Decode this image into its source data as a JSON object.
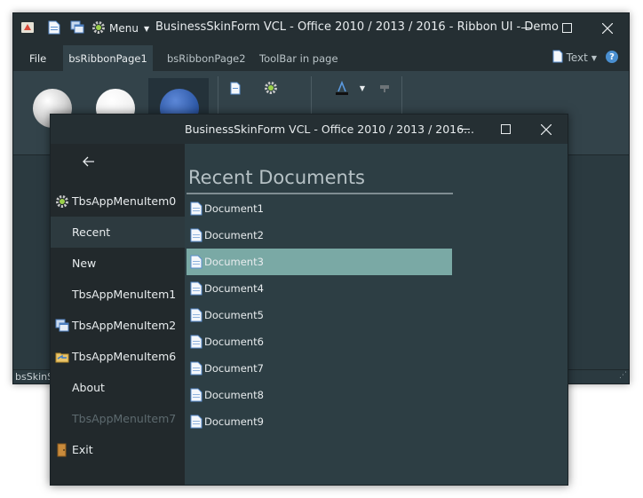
{
  "main_window": {
    "title": "BusinessSkinForm VCL - Office 2010 / 2013 / 2016 - Ribbon UI - Demo",
    "menu_label": "Menu",
    "tabs": [
      {
        "label": "File"
      },
      {
        "label": "bsRibbonPage1"
      },
      {
        "label": "bsRibbonPage2"
      },
      {
        "label": "ToolBar in page"
      }
    ],
    "text_button_label": "Text",
    "help_label": "?",
    "status_text": "bsSkinSt"
  },
  "app_menu_window": {
    "title": "BusinessSkinForm VCL - Office 2010 / 2013 / 2016...",
    "sidebar_items": [
      {
        "label": "TbsAppMenuItem0",
        "icon": "gear-icon"
      },
      {
        "label": "Recent",
        "icon": ""
      },
      {
        "label": "New",
        "icon": ""
      },
      {
        "label": "TbsAppMenuItem1",
        "icon": ""
      },
      {
        "label": "TbsAppMenuItem2",
        "icon": "copy-window-icon"
      },
      {
        "label": "TbsAppMenuItem6",
        "icon": "folder-arrow-icon"
      },
      {
        "label": "About",
        "icon": ""
      },
      {
        "label": "TbsAppMenuItem7",
        "icon": ""
      },
      {
        "label": "Exit",
        "icon": "door-icon"
      }
    ],
    "selected_sidebar_item": "Recent",
    "disabled_sidebar_item": "TbsAppMenuItem7",
    "content": {
      "heading": "Recent Documents",
      "documents": [
        "Document1",
        "Document2",
        "Document3",
        "Document4",
        "Document5",
        "Document6",
        "Document7",
        "Document8",
        "Document9"
      ],
      "selected_document": "Document3"
    }
  },
  "colors": {
    "title_bar": "#252f33",
    "ribbon": "#33434a",
    "sidebar": "#22292c",
    "content_bg": "#2d3e44",
    "selection": "#7aa9a5",
    "text": "#e8ecee"
  }
}
